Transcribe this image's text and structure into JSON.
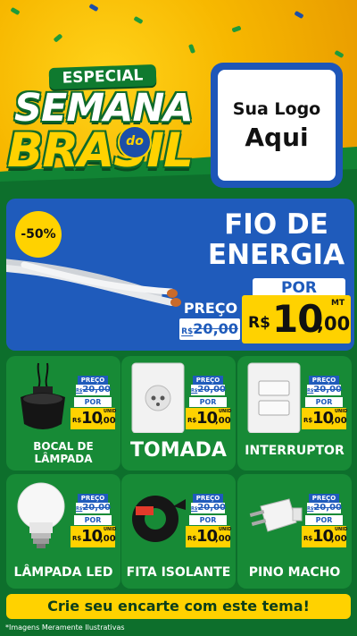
{
  "header": {
    "especial": "ESPECIAL",
    "semana": "SEMANA",
    "do": "do",
    "brasil": "BRASIL",
    "logo_line1": "Sua Logo",
    "logo_line2": "Aqui"
  },
  "featured": {
    "discount": "-50%",
    "title_line1": "FIO DE",
    "title_line2": "ENERGIA",
    "por_label": "POR",
    "preco_label": "PREÇO",
    "old_currency": "R$",
    "old_price_int": "20",
    "old_price_dec": ",00",
    "currency": "R$",
    "price_int": "10",
    "price_dec": ",00",
    "unit": "MT"
  },
  "products": [
    {
      "name_line1": "BOCAL DE",
      "name_line2": "LÂMPADA",
      "preco_label": "PREÇO",
      "old_currency": "R$",
      "old_int": "20",
      "old_dec": ",00",
      "por_label": "POR",
      "currency": "R$",
      "price_int": "10",
      "price_dec": ",00",
      "unit": "UNID"
    },
    {
      "name": "TOMADA",
      "preco_label": "PREÇO",
      "old_currency": "R$",
      "old_int": "20",
      "old_dec": ",00",
      "por_label": "POR",
      "currency": "R$",
      "price_int": "10",
      "price_dec": ",00",
      "unit": "UNID"
    },
    {
      "name": "INTERRUPTOR",
      "preco_label": "PREÇO",
      "old_currency": "R$",
      "old_int": "20",
      "old_dec": ",00",
      "por_label": "POR",
      "currency": "R$",
      "price_int": "10",
      "price_dec": ",00",
      "unit": "UNID"
    },
    {
      "name": "LÂMPADA LED",
      "preco_label": "PREÇO",
      "old_currency": "R$",
      "old_int": "20",
      "old_dec": ",00",
      "por_label": "POR",
      "currency": "R$",
      "price_int": "10",
      "price_dec": ",00",
      "unit": "UNID"
    },
    {
      "name": "FITA ISOLANTE",
      "preco_label": "PREÇO",
      "old_currency": "R$",
      "old_int": "20",
      "old_dec": ",00",
      "por_label": "POR",
      "currency": "R$",
      "price_int": "10",
      "price_dec": ",00",
      "unit": "UNID"
    },
    {
      "name": "PINO MACHO",
      "preco_label": "PREÇO",
      "old_currency": "R$",
      "old_int": "20",
      "old_dec": ",00",
      "por_label": "POR",
      "currency": "R$",
      "price_int": "10",
      "price_dec": ",00",
      "unit": "UNID"
    }
  ],
  "footer": {
    "cta": "Crie seu encarte com este tema!",
    "disclaimer": "*Imagens Meramente Ilustrativas"
  },
  "colors": {
    "brand_green": "#0d6f2c",
    "card_green": "#178a36",
    "brand_yellow": "#ffd200",
    "brand_blue": "#1f5bbb"
  }
}
